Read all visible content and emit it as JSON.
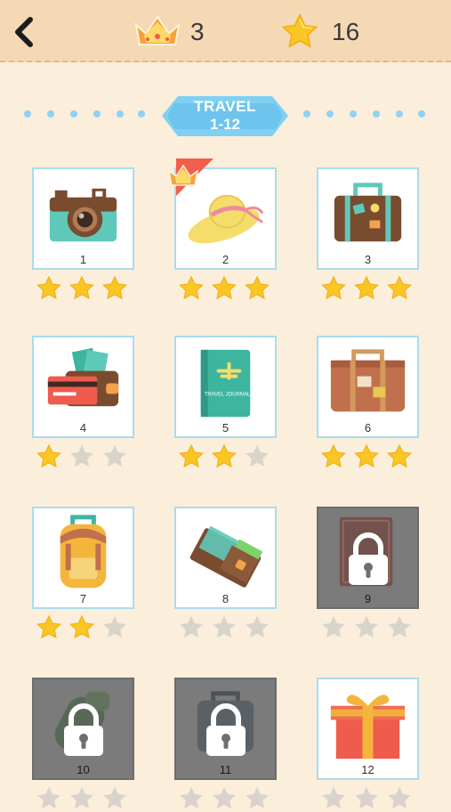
{
  "header": {
    "crowns": "3",
    "stars": "16"
  },
  "category": {
    "title": "TRAVEL",
    "range": "1-12"
  },
  "levels": [
    {
      "number": "1",
      "stars": 3,
      "locked": false,
      "crowned": false,
      "icon": "camera-icon"
    },
    {
      "number": "2",
      "stars": 3,
      "locked": false,
      "crowned": true,
      "icon": "sun-hat-icon"
    },
    {
      "number": "3",
      "stars": 3,
      "locked": false,
      "crowned": false,
      "icon": "suitcase-icon"
    },
    {
      "number": "4",
      "stars": 1,
      "locked": false,
      "crowned": false,
      "icon": "wallet-icon"
    },
    {
      "number": "5",
      "stars": 2,
      "locked": false,
      "crowned": false,
      "icon": "travel-journal-icon"
    },
    {
      "number": "6",
      "stars": 3,
      "locked": false,
      "crowned": false,
      "icon": "vintage-suitcase-icon"
    },
    {
      "number": "7",
      "stars": 2,
      "locked": false,
      "crowned": false,
      "icon": "backpack-icon"
    },
    {
      "number": "8",
      "stars": 0,
      "locked": false,
      "crowned": false,
      "icon": "open-wallet-icon"
    },
    {
      "number": "9",
      "stars": 0,
      "locked": true,
      "crowned": false,
      "icon": "book-icon"
    },
    {
      "number": "10",
      "stars": 0,
      "locked": true,
      "crowned": false,
      "icon": "sleeping-bag-icon"
    },
    {
      "number": "11",
      "stars": 0,
      "locked": true,
      "crowned": false,
      "icon": "luggage-icon"
    },
    {
      "number": "12",
      "stars": 0,
      "locked": false,
      "crowned": false,
      "icon": "gift-box-icon"
    }
  ],
  "text": {
    "journal_title": "TRAVEL JOURNAL"
  },
  "colors": {
    "header_bg": "#f5d9b4",
    "page_bg": "#fbeedb",
    "banner": "#7fd0f3",
    "star_filled": "#f9c623",
    "star_empty": "#d9d4cb",
    "tile_border": "#a9dcef",
    "locked_tile": "#7b7b7b"
  }
}
